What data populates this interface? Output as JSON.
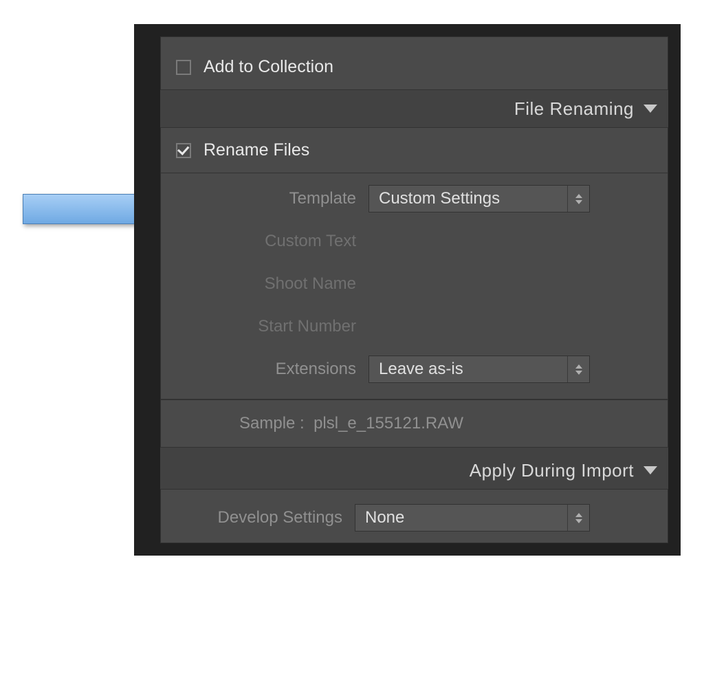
{
  "collection": {
    "add_label": "Add to Collection",
    "checked": false
  },
  "file_renaming": {
    "header": "File Renaming",
    "rename_files_label": "Rename Files",
    "rename_files_checked": true,
    "template_label": "Template",
    "template_value": "Custom Settings",
    "custom_text_label": "Custom Text",
    "shoot_name_label": "Shoot Name",
    "start_number_label": "Start Number",
    "extensions_label": "Extensions",
    "extensions_value": "Leave as-is",
    "sample_label": "Sample :",
    "sample_value": "plsl_e_155121.RAW"
  },
  "apply_during_import": {
    "header": "Apply During Import",
    "develop_settings_label": "Develop Settings",
    "develop_settings_value": "None"
  }
}
